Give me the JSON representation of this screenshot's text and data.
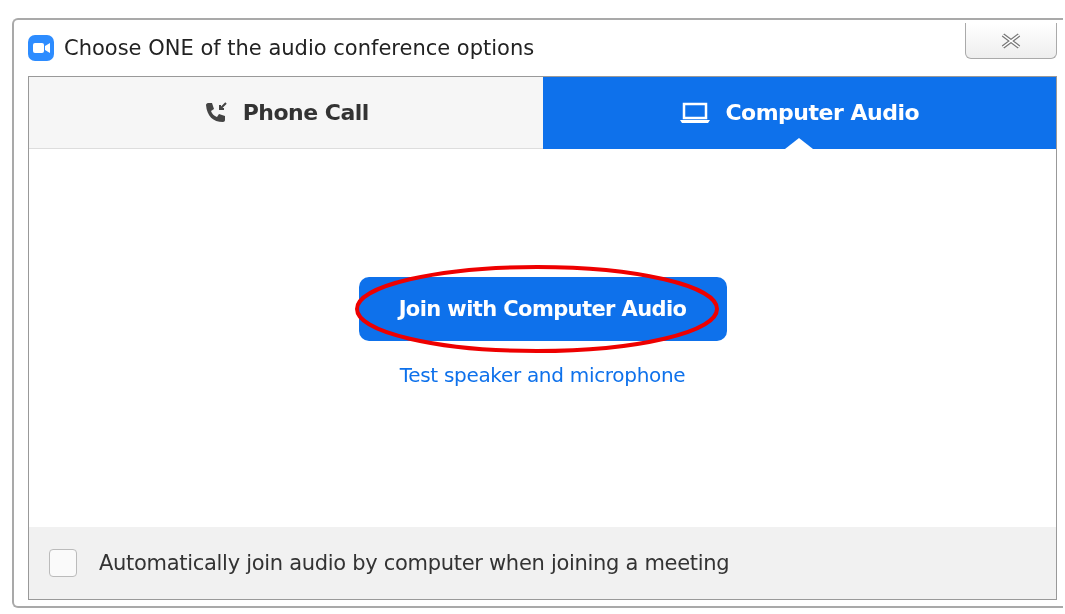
{
  "window": {
    "title": "Choose ONE of the audio conference options"
  },
  "tabs": [
    {
      "label": "Phone Call",
      "kind": "phone",
      "selected": false
    },
    {
      "label": "Computer Audio",
      "kind": "computer",
      "selected": true
    }
  ],
  "join_button": {
    "label": "Join with Computer Audio",
    "highlighted": true
  },
  "test_link": "Test speaker and microphone",
  "auto_join": {
    "label": "Automatically join audio by computer when joining a meeting",
    "checked": false
  }
}
